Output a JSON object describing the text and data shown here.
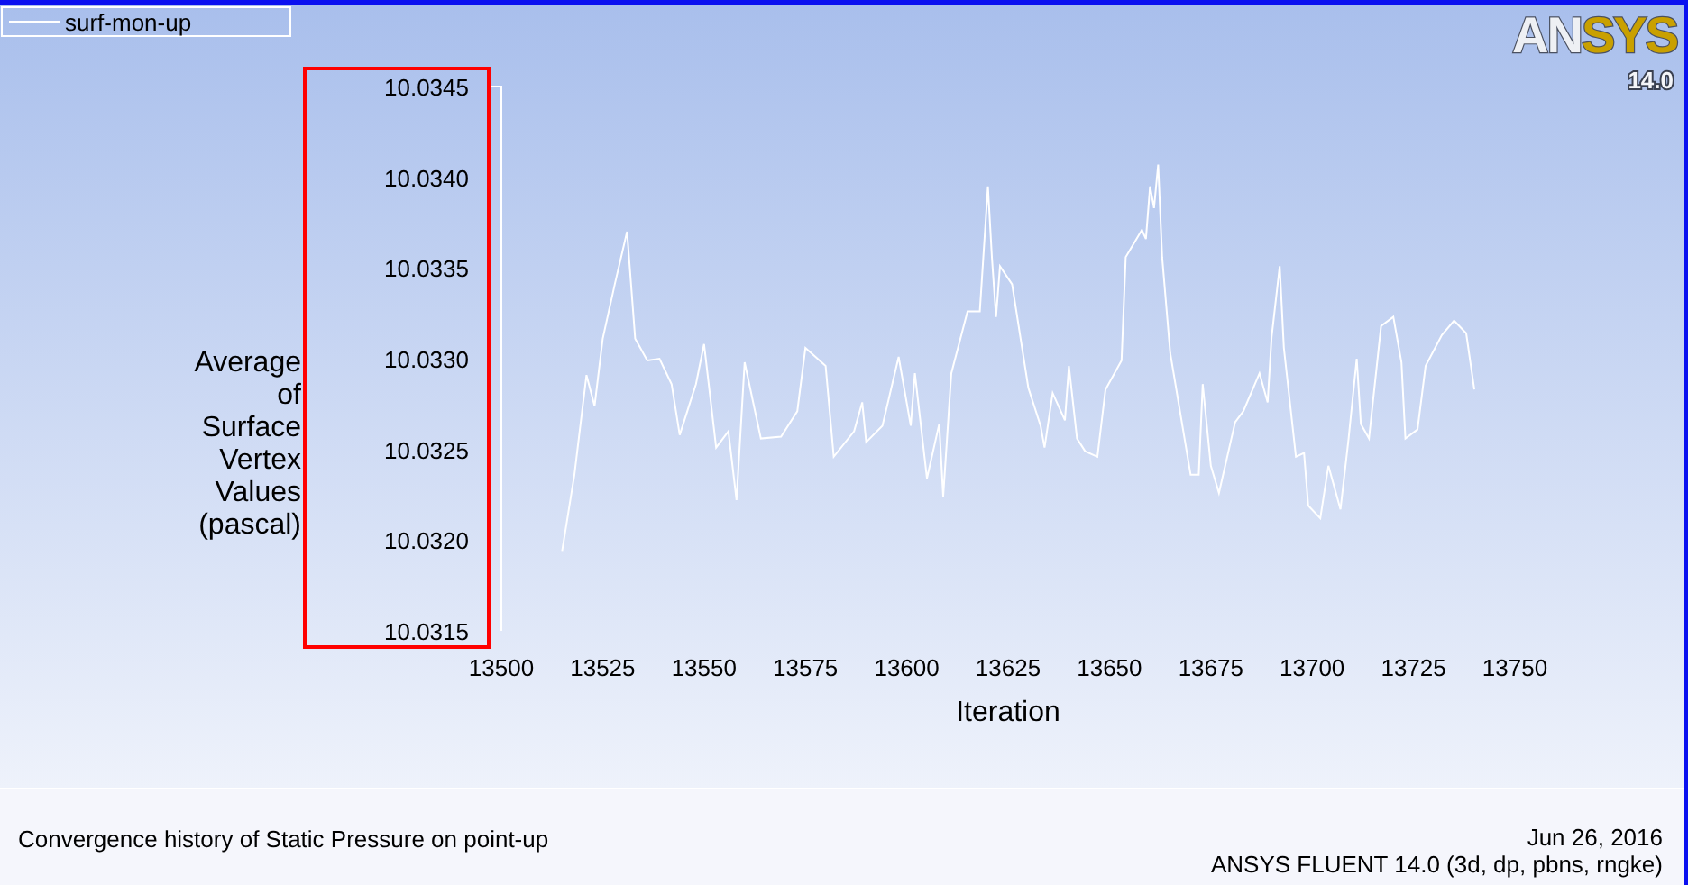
{
  "logo": {
    "text": "ANSYS",
    "version": "14.0"
  },
  "plot": {
    "chart_data": {
      "type": "line",
      "xlabel": "Iteration",
      "ylabel": "Average of Surface Vertex Values (pascal)",
      "x": [
        13515,
        13518,
        13521,
        13523,
        13525,
        13528,
        13531,
        13533,
        13536,
        13539,
        13542,
        13544,
        13548,
        13550,
        13553,
        13556,
        13558,
        13560,
        13564,
        13569,
        13573,
        13575,
        13580,
        13582,
        13587,
        13589,
        13590,
        13594,
        13598,
        13601,
        13602,
        13605,
        13608,
        13609,
        13611,
        13615,
        13618,
        13620,
        13621,
        13622,
        13623,
        13626,
        13630,
        13633,
        13634,
        13636,
        13639,
        13640,
        13642,
        13644,
        13647,
        13649,
        13653,
        13654,
        13658,
        13659,
        13660,
        13661,
        13662,
        13663,
        13665,
        13670,
        13672,
        13673,
        13675,
        13677,
        13681,
        13683,
        13687,
        13689,
        13690,
        13692,
        13693,
        13696,
        13698,
        13699,
        13702,
        13704,
        13707,
        13709,
        13711,
        13712,
        13714,
        13717,
        13720,
        13722,
        13723,
        13726,
        13728,
        13732,
        13735,
        13738,
        13740
      ],
      "series": [
        {
          "name": "surf-mon-up",
          "color": "#ffffff",
          "values": [
            10.03194,
            10.03236,
            10.03291,
            10.03274,
            10.03311,
            10.03341,
            10.0337,
            10.03311,
            10.03299,
            10.033,
            10.03286,
            10.03258,
            10.03286,
            10.03308,
            10.03251,
            10.0326,
            10.03222,
            10.03298,
            10.03256,
            10.03257,
            10.03271,
            10.03306,
            10.03296,
            10.03246,
            10.0326,
            10.03276,
            10.03254,
            10.03263,
            10.03301,
            10.03263,
            10.03292,
            10.03234,
            10.03264,
            10.03224,
            10.03292,
            10.03326,
            10.03326,
            10.03395,
            10.03356,
            10.03323,
            10.03351,
            10.03341,
            10.03284,
            10.03263,
            10.03251,
            10.03281,
            10.03266,
            10.03296,
            10.03256,
            10.03249,
            10.03246,
            10.03283,
            10.03299,
            10.03356,
            10.03371,
            10.03366,
            10.03395,
            10.03383,
            10.03407,
            10.03356,
            10.03303,
            10.03236,
            10.03236,
            10.03286,
            10.03241,
            10.03226,
            10.03265,
            10.03271,
            10.03292,
            10.03276,
            10.03312,
            10.03351,
            10.03306,
            10.03246,
            10.03248,
            10.03219,
            10.03212,
            10.03241,
            10.03217,
            10.03256,
            10.033,
            10.03264,
            10.03256,
            10.03318,
            10.03323,
            10.03298,
            10.03256,
            10.03261,
            10.03296,
            10.03313,
            10.03321,
            10.03314,
            10.03283
          ]
        }
      ],
      "xlim": [
        13500,
        13750
      ],
      "ylim": [
        10.0315,
        10.0345
      ],
      "xticks": [
        13500,
        13525,
        13550,
        13575,
        13600,
        13625,
        13650,
        13675,
        13700,
        13725,
        13750
      ],
      "yticks": [
        {
          "value": 10.0315,
          "label": "10.0315"
        },
        {
          "value": 10.032,
          "label": "10.0320"
        },
        {
          "value": 10.0325,
          "label": "10.0325"
        },
        {
          "value": 10.033,
          "label": "10.0330"
        },
        {
          "value": 10.0335,
          "label": "10.0335"
        },
        {
          "value": 10.034,
          "label": "10.0340"
        },
        {
          "value": 10.0345,
          "label": "10.0345"
        }
      ]
    },
    "highlight": {
      "kind": "rect",
      "color": "#ff0000"
    }
  },
  "footer": {
    "description": "Convergence history of Static Pressure on point-up",
    "date": "Jun 26, 2016",
    "version_info": "ANSYS FLUENT 14.0 (3d, dp, pbns, rngke)"
  }
}
